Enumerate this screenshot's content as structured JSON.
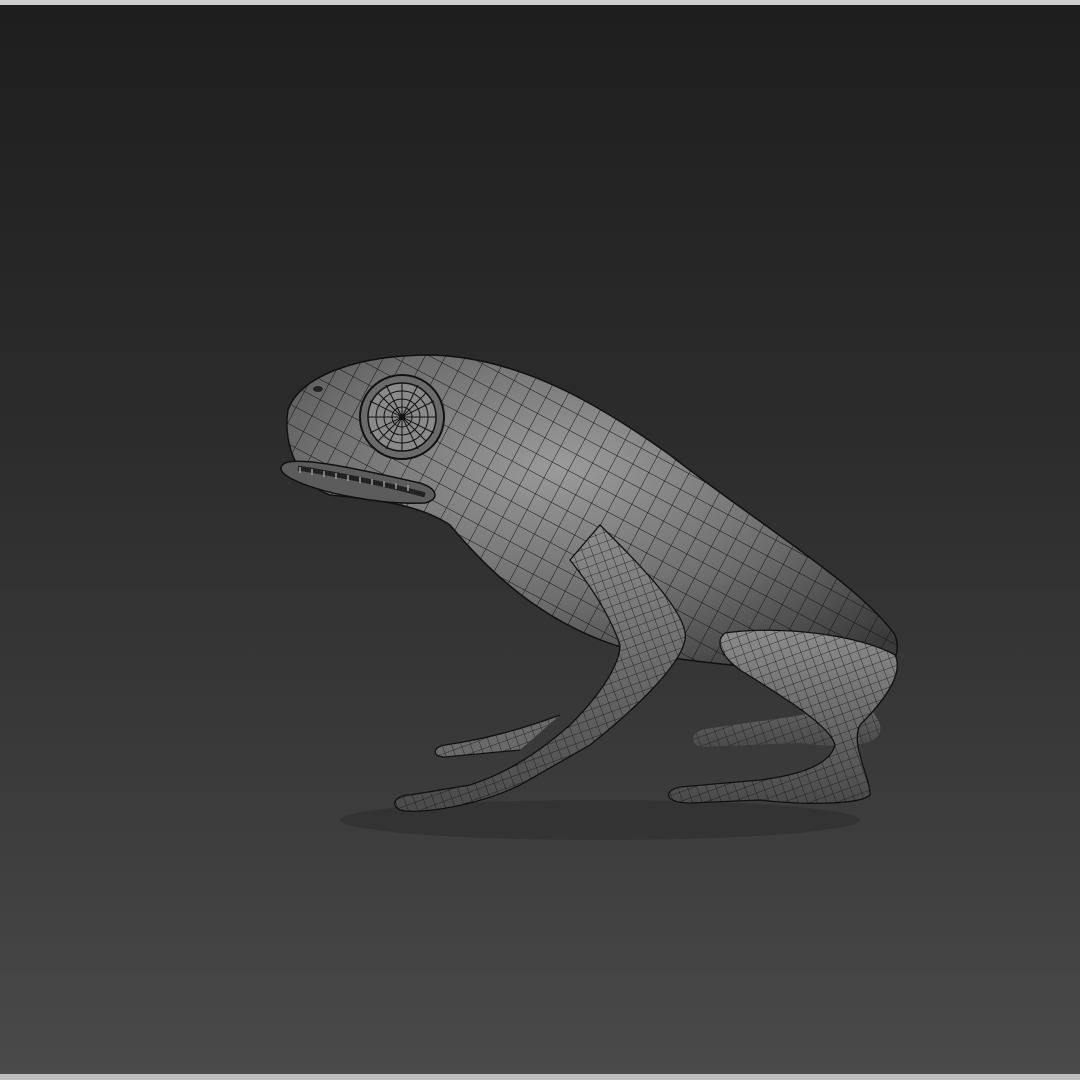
{
  "viewport": {
    "shading_mode": "smooth-with-wireframe",
    "model_icon": "frog-mesh-icon"
  },
  "colors": {
    "background_top": "#1e1e1e",
    "background_bottom": "#4a4a4a",
    "mesh_fill": "#7a7a7a",
    "mesh_lines": "#1a1a1a"
  }
}
